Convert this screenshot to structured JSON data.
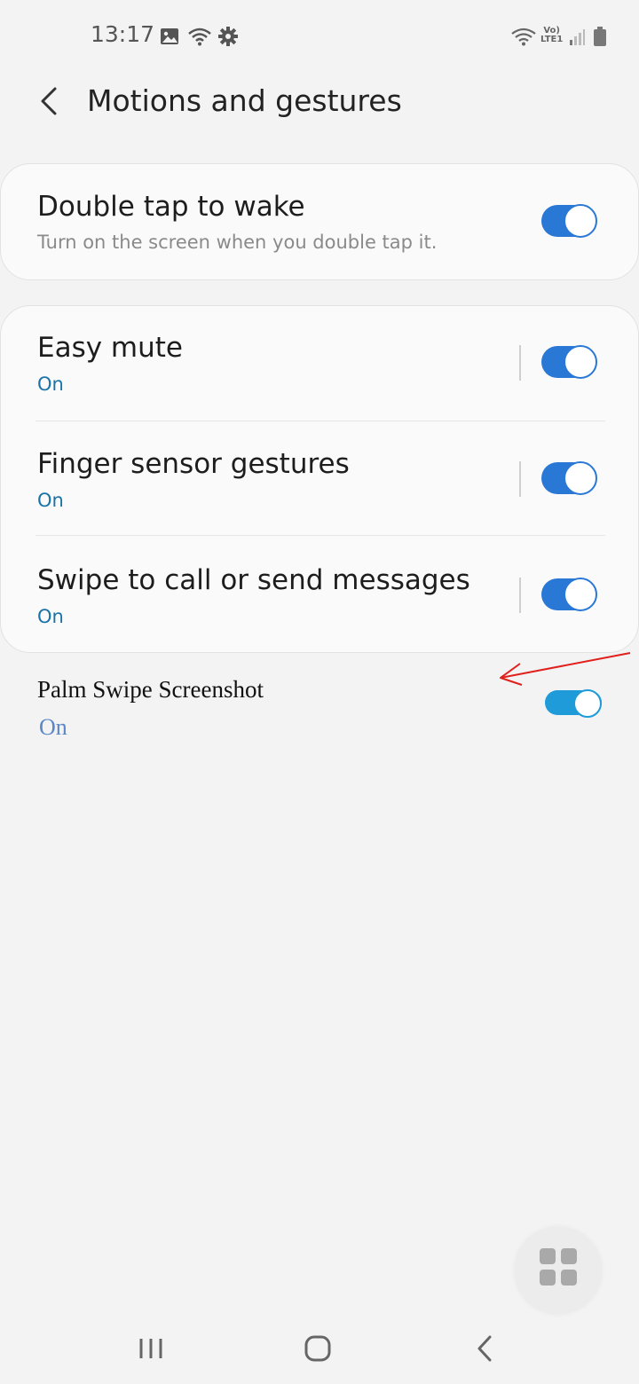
{
  "status_bar": {
    "time": "13:17",
    "network_label_top": "Vo)",
    "network_label_bottom": "LTE1",
    "icons": [
      "gallery-icon",
      "wifi-icon",
      "settings-icon",
      "wifi-icon",
      "signal-icon",
      "battery-icon"
    ]
  },
  "header": {
    "title": "Motions and gestures",
    "back_icon": "chevron-left-icon"
  },
  "card1": {
    "title": "Double tap to wake",
    "subtitle": "Turn on the screen when you double tap it.",
    "enabled": true
  },
  "card2": {
    "items": [
      {
        "title": "Easy mute",
        "status": "On",
        "enabled": true
      },
      {
        "title": "Finger sensor gestures",
        "status": "On",
        "enabled": true
      },
      {
        "title": "Swipe to call or send messages",
        "status": "On",
        "enabled": true
      }
    ]
  },
  "palm": {
    "title": "Palm Swipe Screenshot",
    "status": "On",
    "enabled": true
  },
  "annotation": {
    "arrow_color": "#e0201c"
  },
  "colors": {
    "accent": "#2a78d6",
    "status_text": "#1a73a8",
    "background": "#f3f3f3"
  },
  "nav": {
    "icons": [
      "recents-icon",
      "home-icon",
      "back-icon"
    ]
  },
  "fab": {
    "icon": "apps-grid-icon"
  }
}
